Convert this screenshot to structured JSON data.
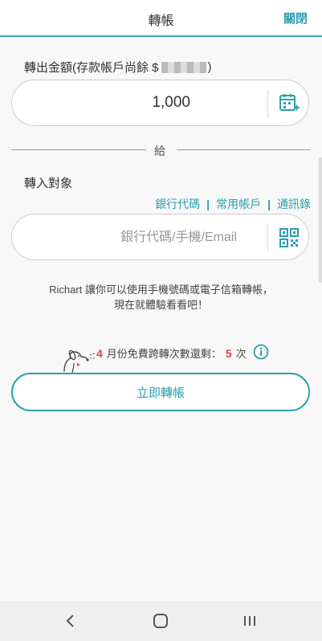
{
  "header": {
    "title": "轉帳",
    "close_label": "關閉"
  },
  "amount": {
    "label_prefix": "轉出金額(存款帳戶尚餘 $",
    "label_suffix": ")",
    "value": "1,000",
    "icon": "calculator-plus-icon"
  },
  "divider_label": "給",
  "target": {
    "label": "轉入對象",
    "links": {
      "bank_code": "銀行代碼",
      "frequent": "常用帳戶",
      "contacts": "通訊錄"
    },
    "separator": "|",
    "placeholder": "銀行代碼/手機/Email",
    "icon": "qr-code-icon"
  },
  "promo": {
    "line1": "Richart 讓你可以使用手機號碼或電子信箱轉帳，",
    "line2": "現在就體驗看看吧！"
  },
  "quota": {
    "month": "4",
    "text_mid": "月份免費跨轉次數還剩：",
    "count": "5",
    "unit": "次"
  },
  "submit_label": "立即轉帳",
  "colors": {
    "accent": "#2a9fb0",
    "highlight": "#e0423a",
    "underline": "#f07b1d"
  }
}
